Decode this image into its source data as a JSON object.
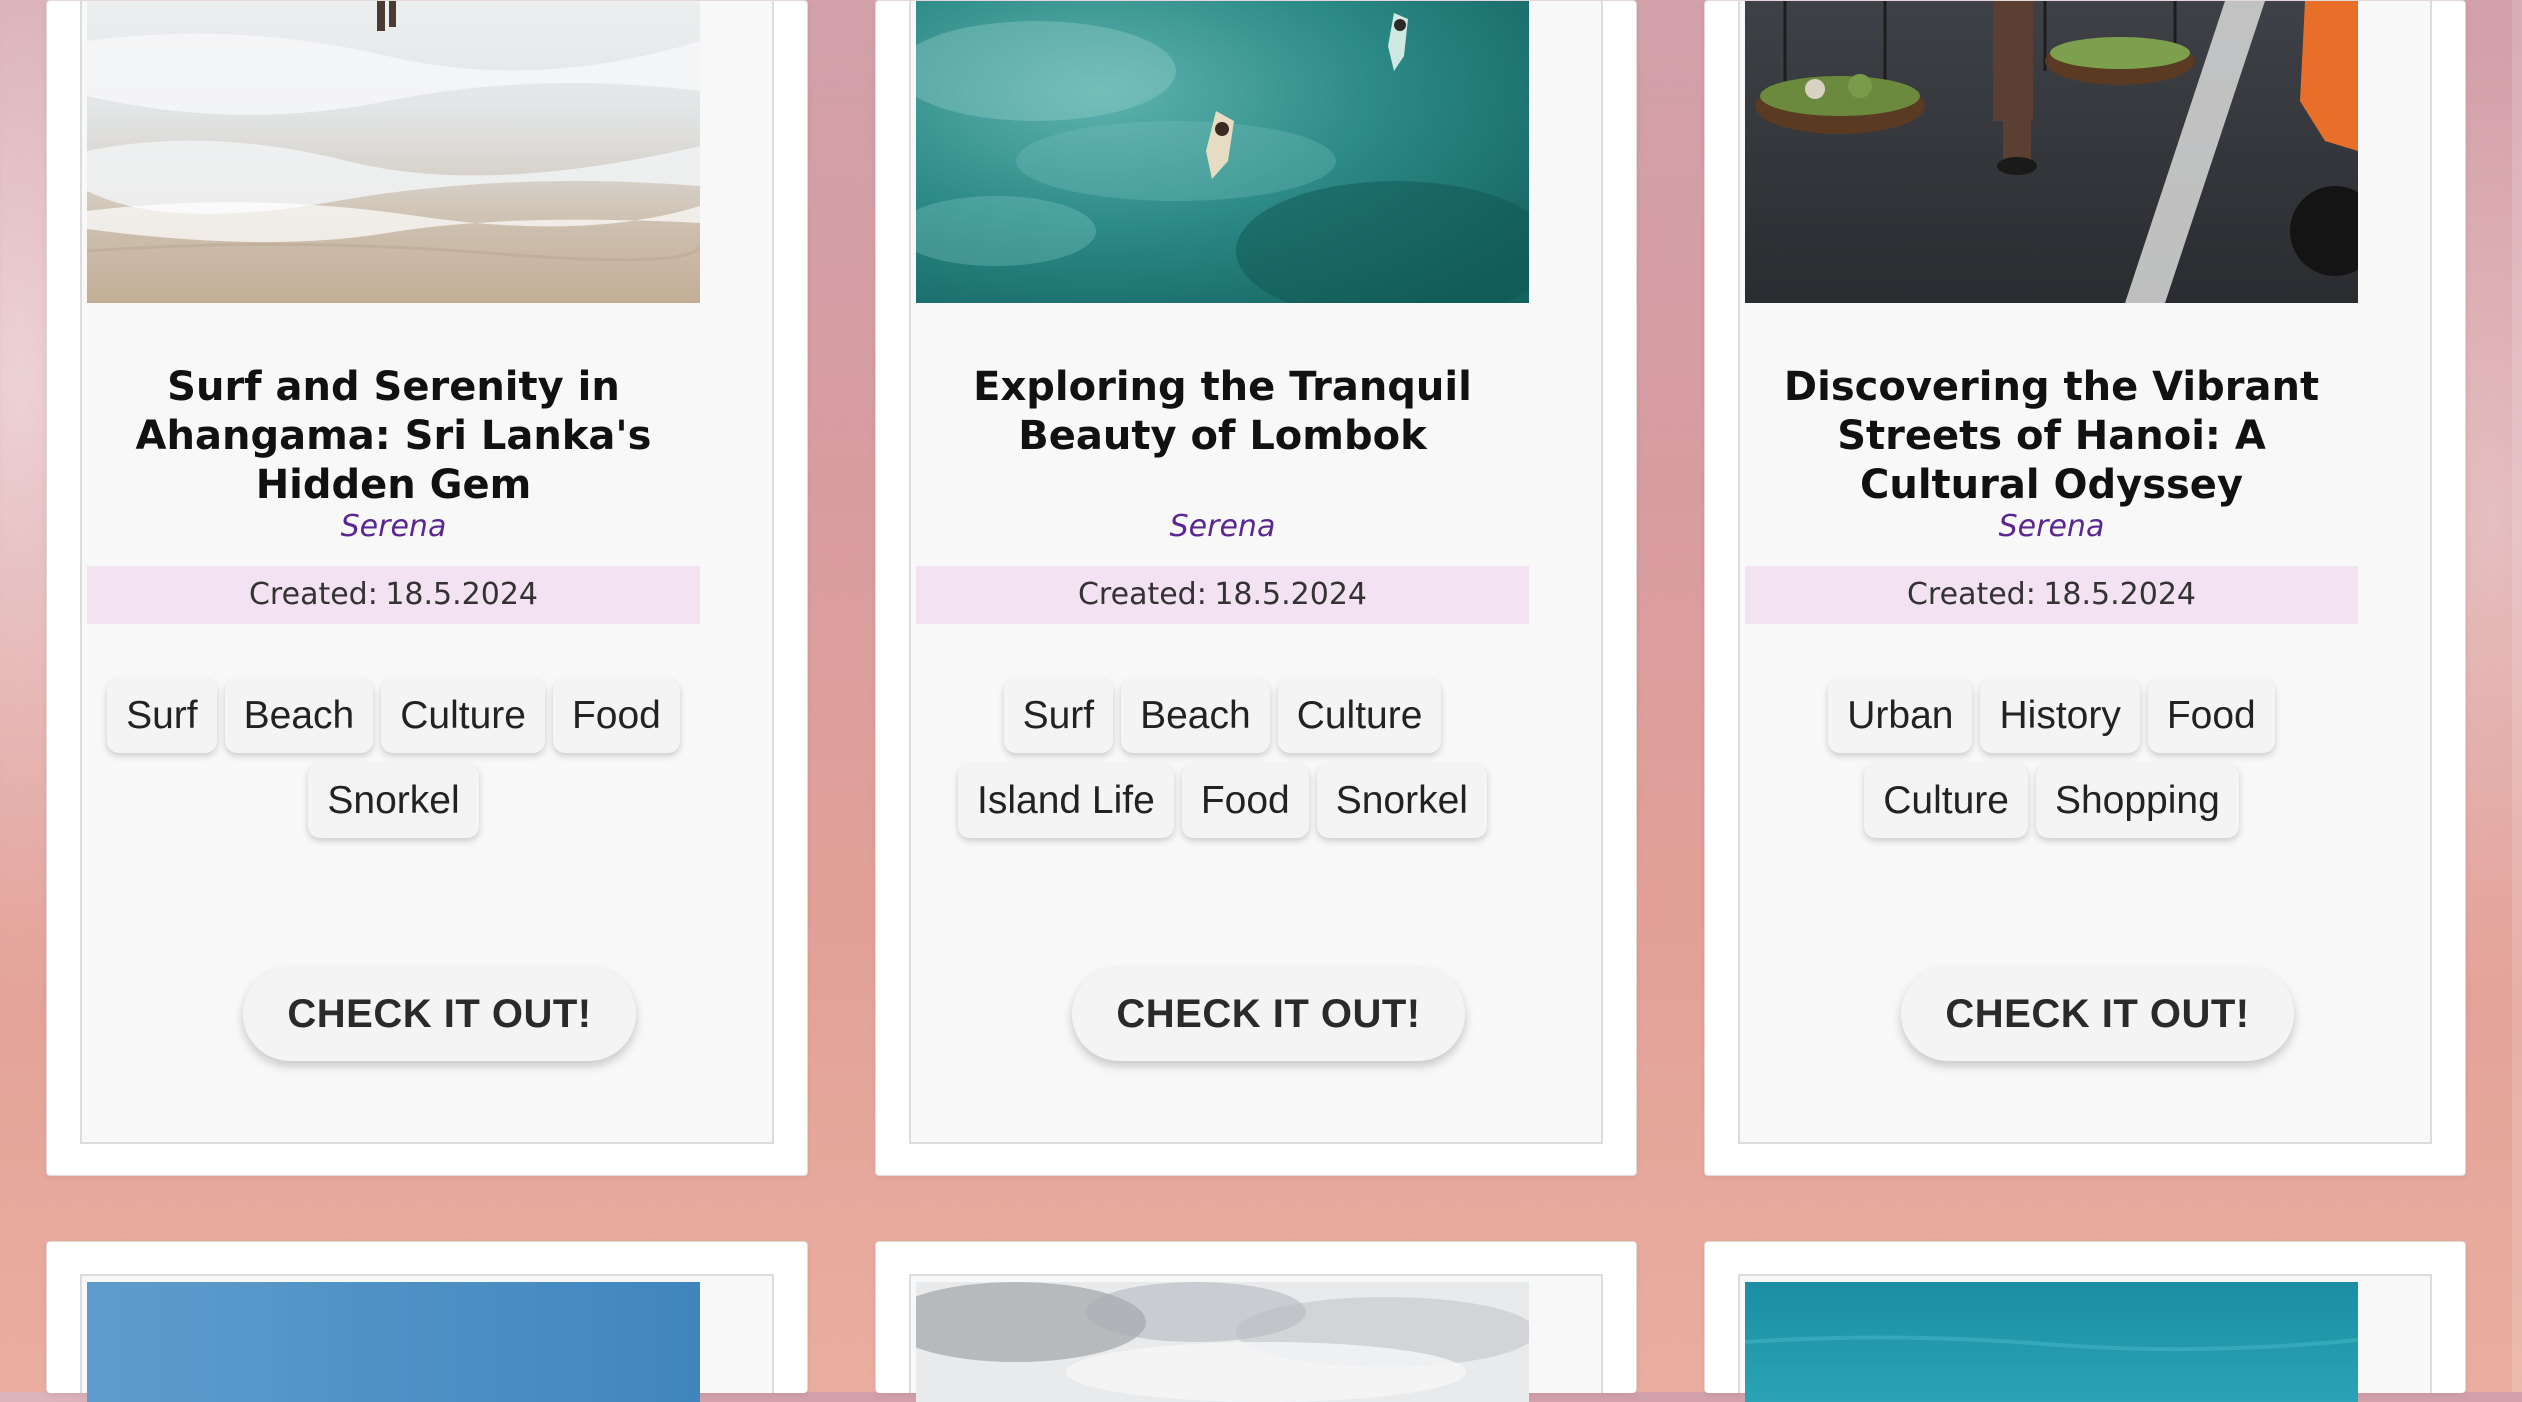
{
  "cards": [
    {
      "title": "Surf and Serenity in Ahangama: Sri Lanka's Hidden Gem",
      "author": "Serena",
      "created_label": "Created:",
      "created_date": "18.5.2024",
      "tags": [
        "Surf",
        "Beach",
        "Culture",
        "Food",
        "Snorkel"
      ],
      "cta": "CHECK IT OUT!"
    },
    {
      "title": "Exploring the Tranquil Beauty of Lombok",
      "author": "Serena",
      "created_label": "Created:",
      "created_date": "18.5.2024",
      "tags": [
        "Surf",
        "Beach",
        "Culture",
        "Island Life",
        "Food",
        "Snorkel"
      ],
      "cta": "CHECK IT OUT!"
    },
    {
      "title": "Discovering the Vibrant Streets of Hanoi: A Cultural Odyssey",
      "author": "Serena",
      "created_label": "Created:",
      "created_date": "18.5.2024",
      "tags": [
        "Urban",
        "History",
        "Food",
        "Culture",
        "Shopping"
      ],
      "cta": "CHECK IT OUT!"
    }
  ],
  "photos": {
    "ahangama": "beach-surf-photo",
    "lombok": "aerial-surfers-photo",
    "hanoi": "street-vendor-photo",
    "row2_left": "blue-sky-photo",
    "row2_middle": "cloudy-sky-photo",
    "row2_right": "turquoise-sea-photo"
  },
  "colors": {
    "author": "#5a2790",
    "created_bg": "#f3e2f1",
    "card_inner_bg": "#f8f8f8"
  }
}
